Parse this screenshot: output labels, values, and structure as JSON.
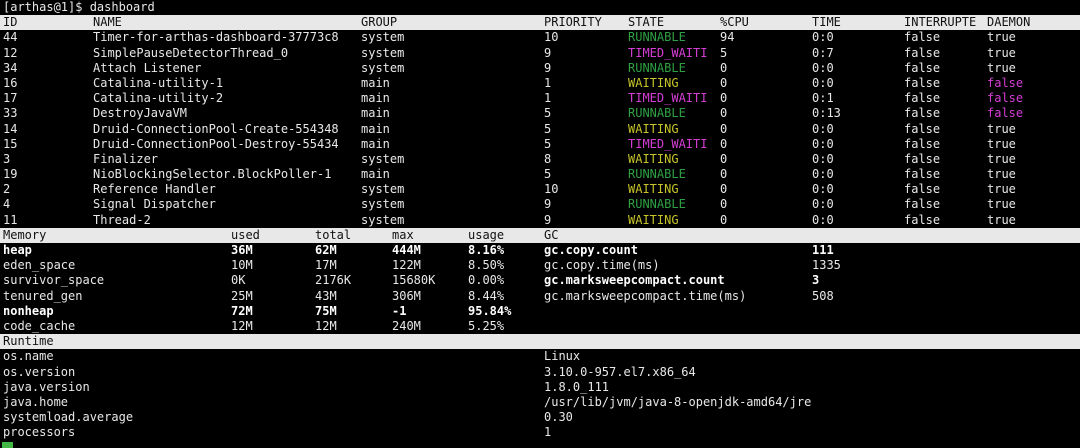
{
  "prompt": "[arthas@1]$ dashboard",
  "colors": {
    "runnable": "#2ea043",
    "waiting": "#c7c429",
    "timed_waiting": "#d63dd6",
    "daemon_false": "#d63dd6"
  },
  "threads": {
    "headers": [
      "ID",
      "NAME",
      "GROUP",
      "PRIORITY",
      "STATE",
      "%CPU",
      "TIME",
      "INTERRUPTE",
      "DAEMON"
    ],
    "rows": [
      {
        "id": "44",
        "name": "Timer-for-arthas-dashboard-37773c8",
        "group": "system",
        "priority": "10",
        "state": "RUNNABLE",
        "cpu": "94",
        "time": "0:0",
        "interrupted": "false",
        "daemon": "true"
      },
      {
        "id": "12",
        "name": "SimplePauseDetectorThread_0",
        "group": "system",
        "priority": "9",
        "state": "TIMED_WAITI",
        "cpu": "5",
        "time": "0:7",
        "interrupted": "false",
        "daemon": "true"
      },
      {
        "id": "34",
        "name": "Attach Listener",
        "group": "system",
        "priority": "9",
        "state": "RUNNABLE",
        "cpu": "0",
        "time": "0:0",
        "interrupted": "false",
        "daemon": "true"
      },
      {
        "id": "16",
        "name": "Catalina-utility-1",
        "group": "main",
        "priority": "1",
        "state": "WAITING",
        "cpu": "0",
        "time": "0:0",
        "interrupted": "false",
        "daemon": "false"
      },
      {
        "id": "17",
        "name": "Catalina-utility-2",
        "group": "main",
        "priority": "1",
        "state": "TIMED_WAITI",
        "cpu": "0",
        "time": "0:1",
        "interrupted": "false",
        "daemon": "false"
      },
      {
        "id": "33",
        "name": "DestroyJavaVM",
        "group": "main",
        "priority": "5",
        "state": "RUNNABLE",
        "cpu": "0",
        "time": "0:13",
        "interrupted": "false",
        "daemon": "false"
      },
      {
        "id": "14",
        "name": "Druid-ConnectionPool-Create-554348",
        "group": "main",
        "priority": "5",
        "state": "WAITING",
        "cpu": "0",
        "time": "0:0",
        "interrupted": "false",
        "daemon": "true"
      },
      {
        "id": "15",
        "name": "Druid-ConnectionPool-Destroy-55434",
        "group": "main",
        "priority": "5",
        "state": "TIMED_WAITI",
        "cpu": "0",
        "time": "0:0",
        "interrupted": "false",
        "daemon": "true"
      },
      {
        "id": "3",
        "name": "Finalizer",
        "group": "system",
        "priority": "8",
        "state": "WAITING",
        "cpu": "0",
        "time": "0:0",
        "interrupted": "false",
        "daemon": "true"
      },
      {
        "id": "19",
        "name": "NioBlockingSelector.BlockPoller-1",
        "group": "main",
        "priority": "5",
        "state": "RUNNABLE",
        "cpu": "0",
        "time": "0:0",
        "interrupted": "false",
        "daemon": "true"
      },
      {
        "id": "2",
        "name": "Reference Handler",
        "group": "system",
        "priority": "10",
        "state": "WAITING",
        "cpu": "0",
        "time": "0:0",
        "interrupted": "false",
        "daemon": "true"
      },
      {
        "id": "4",
        "name": "Signal Dispatcher",
        "group": "system",
        "priority": "9",
        "state": "RUNNABLE",
        "cpu": "0",
        "time": "0:0",
        "interrupted": "false",
        "daemon": "true"
      },
      {
        "id": "11",
        "name": "Thread-2",
        "group": "system",
        "priority": "9",
        "state": "WAITING",
        "cpu": "0",
        "time": "0:0",
        "interrupted": "false",
        "daemon": "true"
      }
    ]
  },
  "memory": {
    "headers": [
      "Memory",
      "used",
      "total",
      "max",
      "usage"
    ],
    "rows": [
      {
        "name": "heap",
        "used": "36M",
        "total": "62M",
        "max": "444M",
        "usage": "8.16%",
        "bold": true
      },
      {
        "name": "eden_space",
        "used": "10M",
        "total": "17M",
        "max": "122M",
        "usage": "8.50%",
        "bold": false
      },
      {
        "name": "survivor_space",
        "used": "0K",
        "total": "2176K",
        "max": "15680K",
        "usage": "0.00%",
        "bold": false
      },
      {
        "name": "tenured_gen",
        "used": "25M",
        "total": "43M",
        "max": "306M",
        "usage": "8.44%",
        "bold": false
      },
      {
        "name": "nonheap",
        "used": "72M",
        "total": "75M",
        "max": "-1",
        "usage": "95.84%",
        "bold": true
      },
      {
        "name": "code_cache",
        "used": "12M",
        "total": "12M",
        "max": "240M",
        "usage": "5.25%",
        "bold": false
      }
    ]
  },
  "gc": {
    "header": "GC",
    "rows": [
      {
        "name": "gc.copy.count",
        "value": "111",
        "bold": true
      },
      {
        "name": "gc.copy.time(ms)",
        "value": "1335",
        "bold": false
      },
      {
        "name": "gc.marksweepcompact.count",
        "value": "3",
        "bold": true
      },
      {
        "name": "gc.marksweepcompact.time(ms)",
        "value": "508",
        "bold": false
      }
    ]
  },
  "runtime": {
    "header": "Runtime",
    "rows": [
      {
        "key": "os.name",
        "value": "Linux"
      },
      {
        "key": "os.version",
        "value": "3.10.0-957.el7.x86_64"
      },
      {
        "key": "java.version",
        "value": "1.8.0_111"
      },
      {
        "key": "java.home",
        "value": "/usr/lib/jvm/java-8-openjdk-amd64/jre"
      },
      {
        "key": "systemload.average",
        "value": "0.30"
      },
      {
        "key": "processors",
        "value": "1"
      }
    ]
  }
}
